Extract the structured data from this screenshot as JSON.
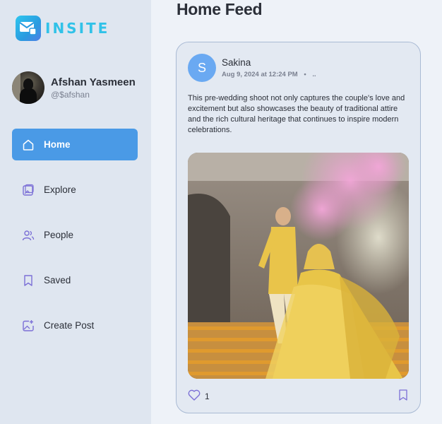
{
  "app": {
    "logo_text": "INSITE"
  },
  "profile": {
    "name": "Afshan Yasmeen",
    "handle": "@$afshan"
  },
  "nav": [
    {
      "label": "Home",
      "icon": "home-icon",
      "active": true
    },
    {
      "label": "Explore",
      "icon": "image-gallery-icon",
      "active": false
    },
    {
      "label": "People",
      "icon": "people-icon",
      "active": false
    },
    {
      "label": "Saved",
      "icon": "bookmark-icon",
      "active": false
    },
    {
      "label": "Create Post",
      "icon": "add-image-icon",
      "active": false
    }
  ],
  "main": {
    "title": "Home Feed"
  },
  "post": {
    "author_initial": "S",
    "author_name": "Sakina",
    "date": "Aug 9, 2024 at 12:24 PM",
    "separator": "•",
    "more": "..",
    "caption": "This pre-wedding shoot not only captures the couple's love and excitement but also showcases the beauty of traditional attire and the rich cultural heritage that continues to inspire modern celebrations.",
    "likes": "1"
  },
  "colors": {
    "sidebar_bg": "#dfe6f0",
    "accent": "#4a9ae6",
    "logo": "#31c2e8",
    "icon_purple": "#7b6fd6"
  }
}
